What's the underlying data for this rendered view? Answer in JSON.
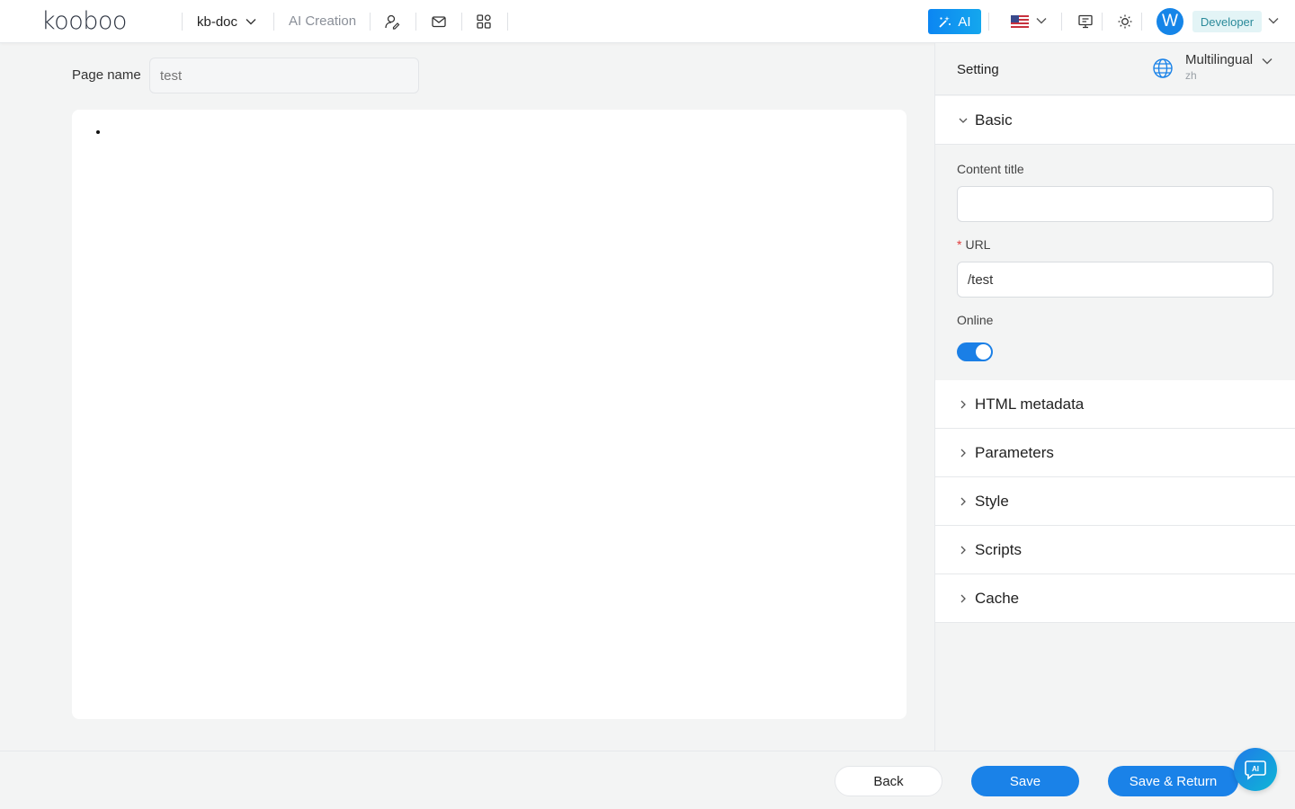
{
  "header": {
    "logo": "kooboo",
    "site": "kb-doc",
    "ai_creation": "AI Creation",
    "ai_button": "AI",
    "avatar_initial": "W",
    "role": "Developer"
  },
  "page": {
    "name_label": "Page name",
    "name_placeholder": "test"
  },
  "panel": {
    "title": "Setting",
    "multilingual_label": "Multilingual",
    "multilingual_lang": "zh",
    "basic": {
      "title": "Basic",
      "content_title_label": "Content title",
      "content_title_value": "",
      "url_required_mark": "*",
      "url_label": "URL",
      "url_value": "/test",
      "online_label": "Online",
      "online": true
    },
    "sections": [
      "HTML metadata",
      "Parameters",
      "Style",
      "Scripts",
      "Cache"
    ]
  },
  "footer": {
    "back": "Back",
    "save": "Save",
    "save_return": "Save & Return"
  },
  "colors": {
    "primary": "#1a82e8",
    "accent_teal": "#2b8a9a",
    "background": "#f3f4f4"
  }
}
